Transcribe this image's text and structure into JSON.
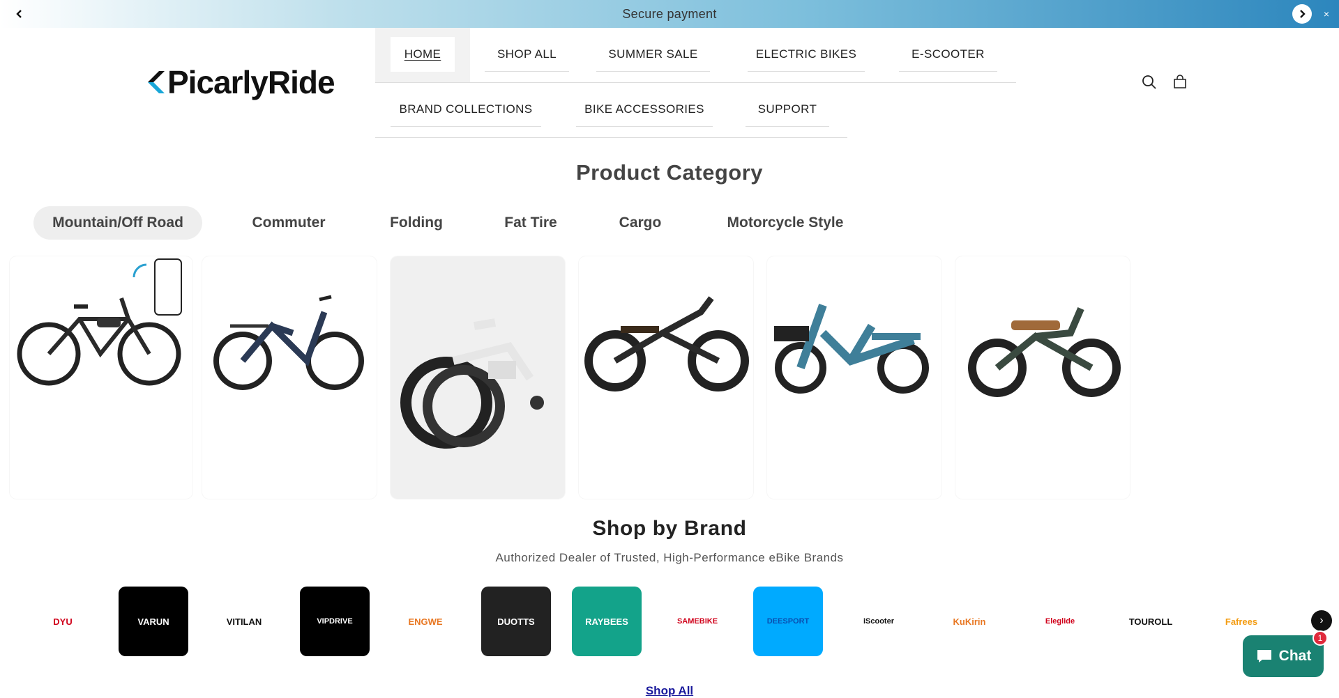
{
  "announcement": {
    "text": "Secure payment",
    "prev_icon": "chevron-left-icon",
    "next_icon": "chevron-right-icon",
    "close_label": "×"
  },
  "header": {
    "logo_text": "PicarlyRide",
    "nav_row1": [
      "HOME",
      "SHOP ALL",
      "SUMMER SALE",
      "ELECTRIC BIKES",
      "E-SCOOTER"
    ],
    "nav_row2": [
      "BRAND COLLECTIONS",
      "BIKE ACCESSORIES",
      "SUPPORT"
    ],
    "search_icon": "search-icon",
    "cart_icon": "cart-icon"
  },
  "product_category": {
    "title": "Product Category",
    "tabs": [
      "Mountain/Off Road",
      "Commuter",
      "Folding",
      "Fat Tire",
      "Cargo",
      "Motorcycle Style"
    ],
    "active_tab": "Mountain/Off Road",
    "cards": [
      {
        "name": "mountain-ebike",
        "color": "#2a2a2a"
      },
      {
        "name": "commuter-ebike",
        "color": "#2b3a55"
      },
      {
        "name": "folding-ebike",
        "color": "#dddddd"
      },
      {
        "name": "fat-tire-ebike",
        "color": "#2a2a2a"
      },
      {
        "name": "cargo-ebike",
        "color": "#3f7f99"
      },
      {
        "name": "motorcycle-style-ebike",
        "color": "#3a4a40"
      }
    ]
  },
  "brands": {
    "title": "Shop by Brand",
    "subtitle": "Authorized Dealer of Trusted, High-Performance eBike Brands",
    "items": [
      {
        "label": "DYU",
        "bg": "#ffffff",
        "fg": "#d0021b"
      },
      {
        "label": "VARUN",
        "bg": "#000000",
        "fg": "#ffffff"
      },
      {
        "label": "VITILAN",
        "bg": "#ffffff",
        "fg": "#111111"
      },
      {
        "label": "VIPDRIVE",
        "bg": "#000000",
        "fg": "#ffffff"
      },
      {
        "label": "ENGWE",
        "bg": "#ffffff",
        "fg": "#e87722"
      },
      {
        "label": "DUOTTS",
        "bg": "#222222",
        "fg": "#ffffff"
      },
      {
        "label": "RAYBEES",
        "bg": "#13a38a",
        "fg": "#ffffff"
      },
      {
        "label": "SAMEBIKE",
        "bg": "#ffffff",
        "fg": "#d0021b"
      },
      {
        "label": "DEESPORT",
        "bg": "#00aaff",
        "fg": "#0a4fb0"
      },
      {
        "label": "iScooter",
        "bg": "#ffffff",
        "fg": "#111111"
      },
      {
        "label": "KuKirin",
        "bg": "#ffffff",
        "fg": "#e87722"
      },
      {
        "label": "Eleglide",
        "bg": "#ffffff",
        "fg": "#d0021b"
      },
      {
        "label": "TOUROLL",
        "bg": "#ffffff",
        "fg": "#111111"
      },
      {
        "label": "Fafrees",
        "bg": "#ffffff",
        "fg": "#f39c12"
      }
    ],
    "next_label": "›",
    "shop_all": "Shop All"
  },
  "chat": {
    "label": "Chat",
    "badge": "1"
  }
}
